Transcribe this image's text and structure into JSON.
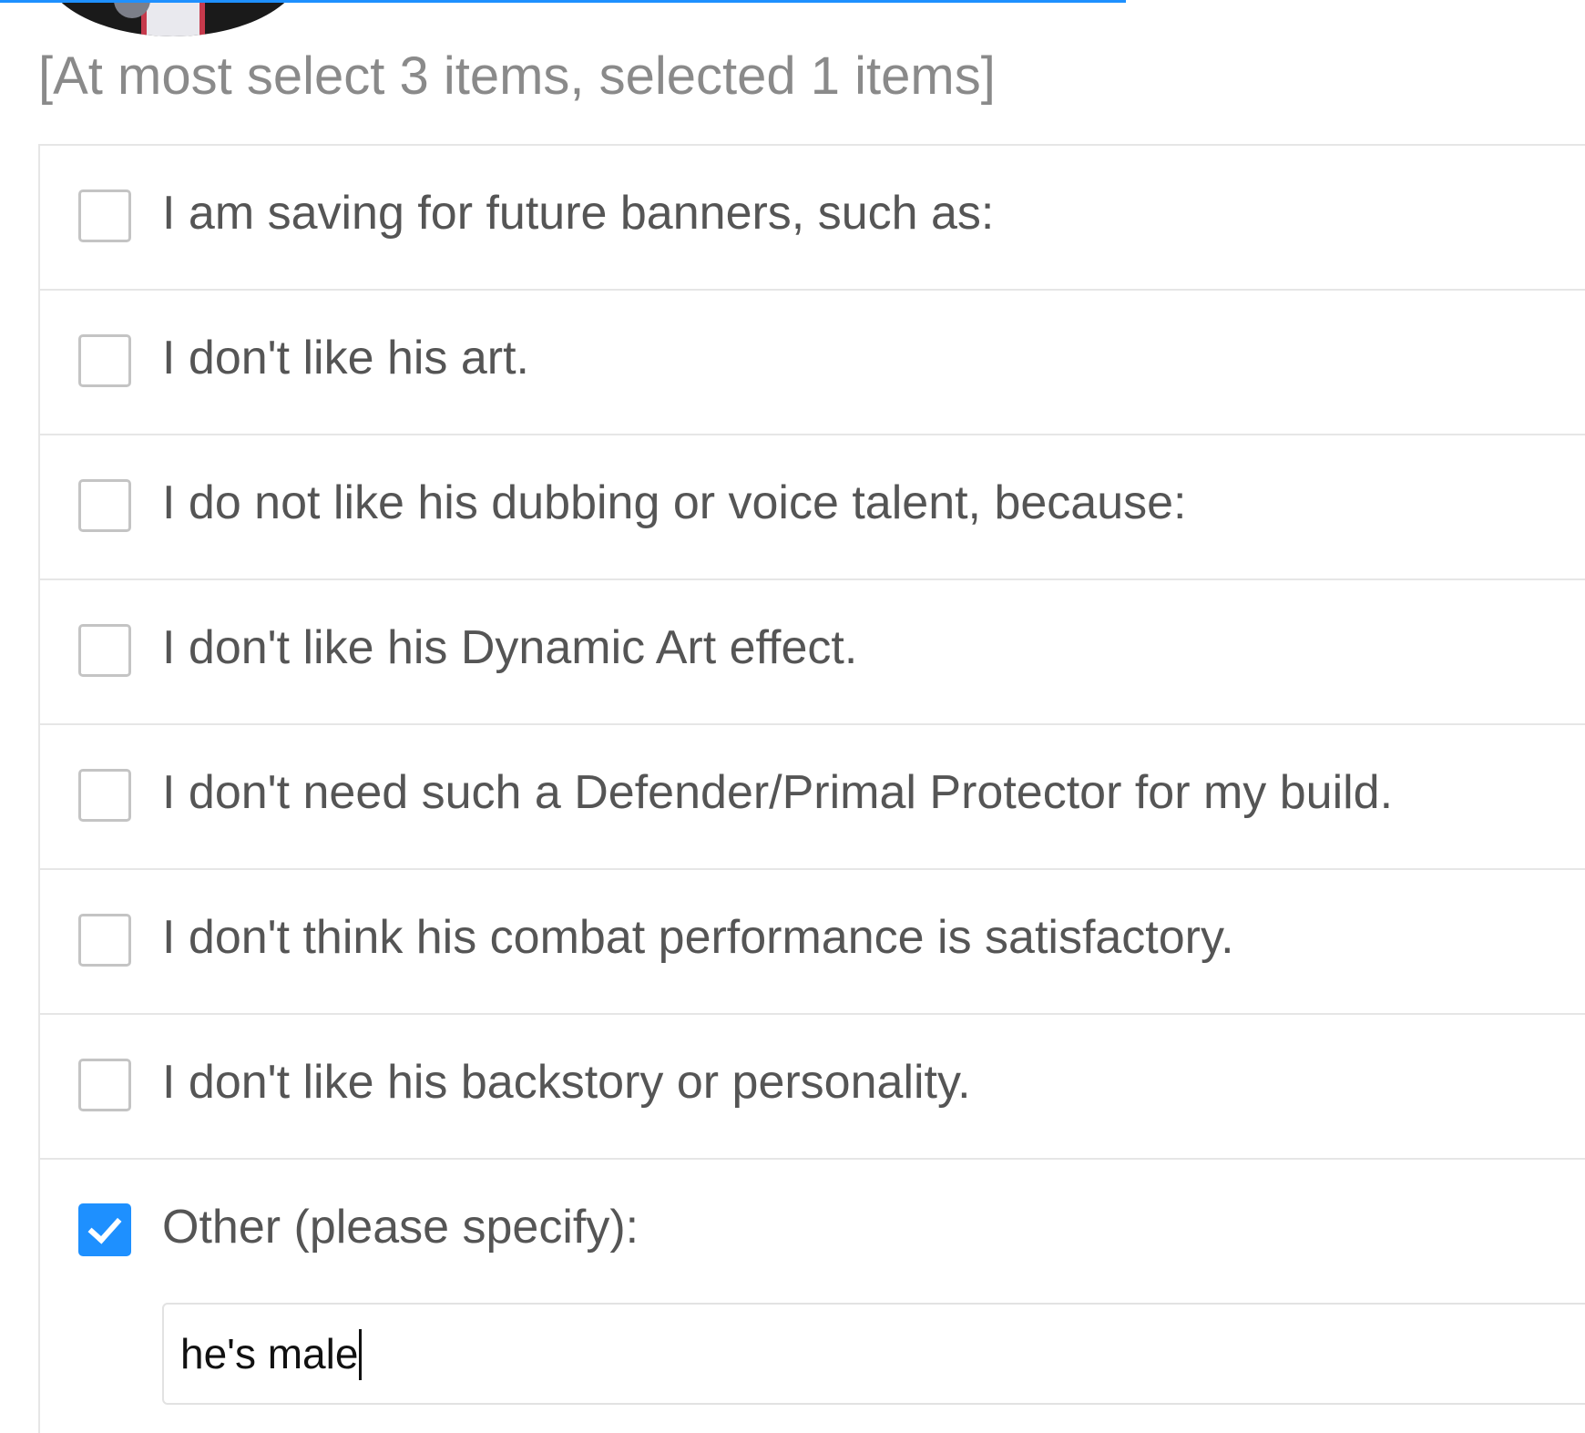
{
  "survey": {
    "selection_hint": "[At most select 3 items, selected 1 items]",
    "options": [
      {
        "label": "I am saving for future banners, such as:",
        "checked": false
      },
      {
        "label": "I don't like his art.",
        "checked": false
      },
      {
        "label": "I do not like his dubbing or voice talent, because:",
        "checked": false
      },
      {
        "label": "I don't like his Dynamic Art effect.",
        "checked": false
      },
      {
        "label": "I don't need such a Defender/Primal Protector for my build.",
        "checked": false
      },
      {
        "label": "I don't think his combat performance is satisfactory.",
        "checked": false
      },
      {
        "label": "I don't like his backstory or personality.",
        "checked": false
      }
    ],
    "other": {
      "label": "Other (please specify):",
      "checked": true,
      "input_value": "he's male"
    }
  },
  "colors": {
    "accent": "#1e90ff",
    "text": "#555555",
    "hint_text": "#8a8a8a",
    "border": "#e6e6e6"
  }
}
